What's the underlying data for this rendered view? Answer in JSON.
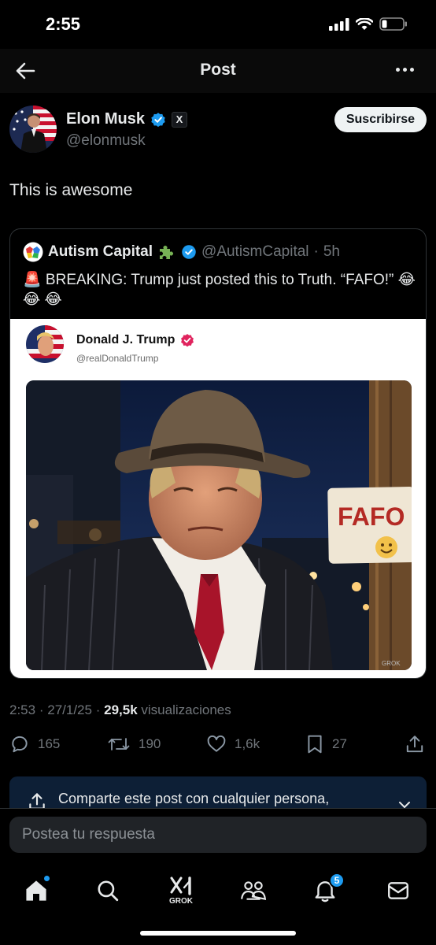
{
  "status_bar": {
    "time": "2:55"
  },
  "header": {
    "title": "Post"
  },
  "post": {
    "author_name": "Elon Musk",
    "author_handle": "@elonmusk",
    "affiliate_badge": "X",
    "subscribe_label": "Suscribirse",
    "text": "This is awesome",
    "time": "2:53",
    "date": "27/1/25",
    "views_count": "29,5k",
    "views_label": "visualizaciones",
    "separator": "·"
  },
  "quote": {
    "author_name": "Autism Capital",
    "author_handle": "@AutismCapital",
    "age": "5h",
    "text": "🚨 BREAKING: Trump just posted this to Truth. “FAFO!” 😂 😂 😂",
    "embed": {
      "name": "Donald J. Trump",
      "handle": "@realDonaldTrump",
      "sign_text": "FAFO",
      "watermark": "GROK"
    }
  },
  "actions": {
    "replies": "165",
    "reposts": "190",
    "likes": "1,6k",
    "bookmarks": "27"
  },
  "share_banner": {
    "text": "Comparte este post con cualquier persona,"
  },
  "reply": {
    "placeholder": "Postea tu respuesta"
  },
  "tabbar": {
    "grok_label": "GROK",
    "notifications_count": "5"
  },
  "colors": {
    "background": "#000000",
    "accent": "#1d9bf0",
    "muted_text": "#71767b",
    "verified_pink": "#e0245e"
  }
}
